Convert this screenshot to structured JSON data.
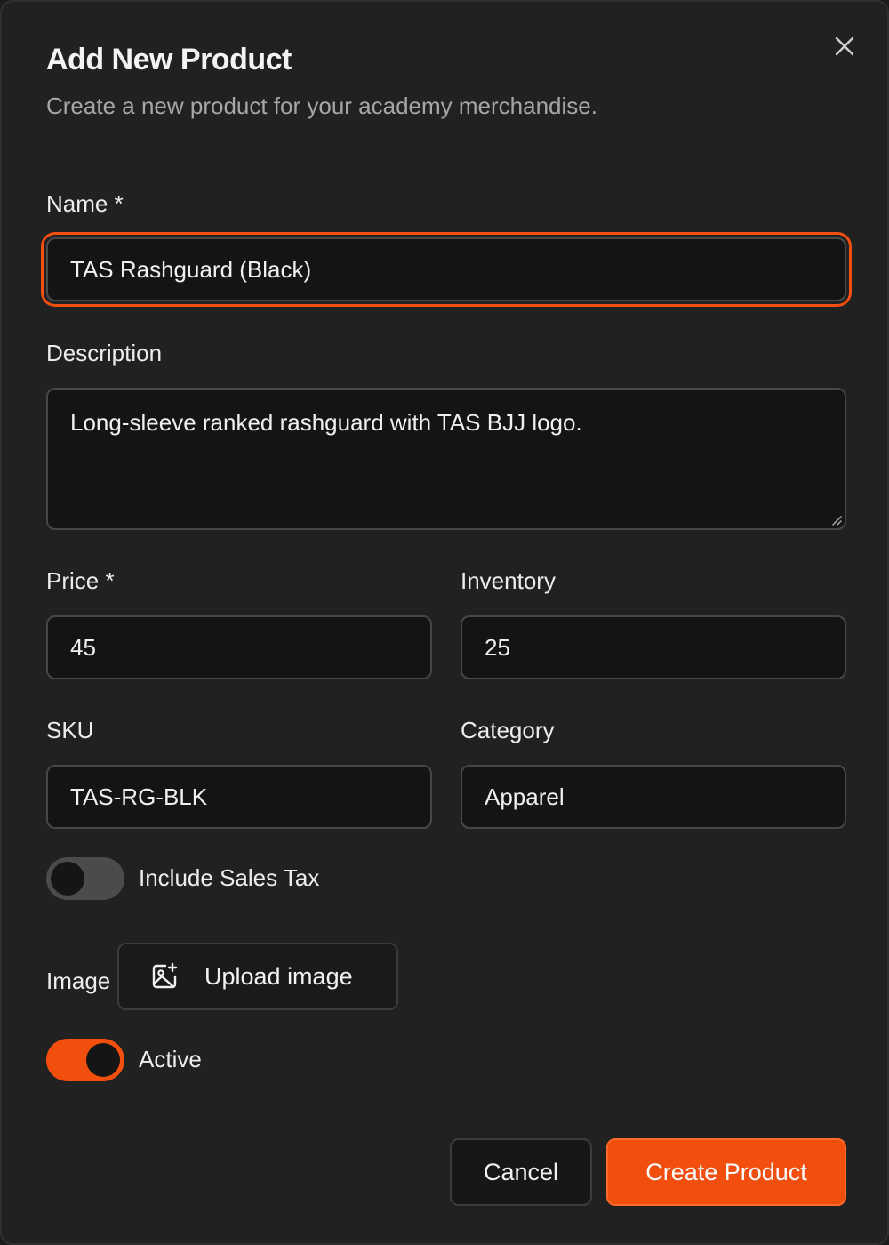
{
  "dialog": {
    "title": "Add New Product",
    "subtitle": "Create a new product for your academy merchandise."
  },
  "form": {
    "name": {
      "label": "Name *",
      "value": "TAS Rashguard (Black)"
    },
    "description": {
      "label": "Description",
      "value": "Long-sleeve ranked rashguard with TAS BJJ logo."
    },
    "price": {
      "label": "Price *",
      "value": "45"
    },
    "inventory": {
      "label": "Inventory",
      "value": "25"
    },
    "sku": {
      "label": "SKU",
      "value": "TAS-RG-BLK"
    },
    "category": {
      "label": "Category",
      "value": "Apparel"
    },
    "sales_tax": {
      "label": "Include Sales Tax",
      "enabled": false
    },
    "image": {
      "label": "Image",
      "upload_label": "Upload image"
    },
    "active": {
      "label": "Active",
      "enabled": true
    }
  },
  "actions": {
    "cancel_label": "Cancel",
    "submit_label": "Create Product"
  },
  "icons": {
    "close": "close-icon",
    "upload": "image-plus-icon"
  },
  "colors": {
    "accent": "#f24e0e",
    "dialog_bg": "#212121",
    "input_bg": "#141414",
    "border": "#474747",
    "muted_text": "#a6a6a6"
  }
}
